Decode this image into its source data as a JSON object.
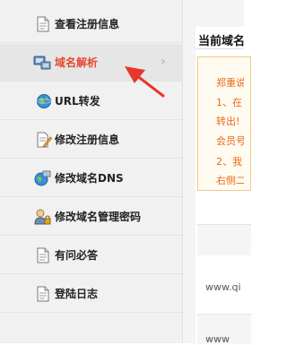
{
  "menu": {
    "items": [
      {
        "label": "查看注册信息",
        "icon": "document-icon"
      },
      {
        "label": "域名解析",
        "icon": "dns-server-icon",
        "active": true
      },
      {
        "label": "URL转发",
        "icon": "globe-icon"
      },
      {
        "label": "修改注册信息",
        "icon": "edit-document-icon"
      },
      {
        "label": "修改域名DNS",
        "icon": "globe-computer-icon"
      },
      {
        "label": "修改域名管理密码",
        "icon": "user-lock-icon"
      },
      {
        "label": "有问必答",
        "icon": "document-icon"
      },
      {
        "label": "登陆日志",
        "icon": "document-icon"
      }
    ],
    "chevron": "›"
  },
  "content": {
    "title": "当前域名",
    "notice_lines": [
      "郑重说",
      "1、在",
      "转出!",
      "会员号",
      "2、我",
      "右侧二"
    ],
    "url_rows": [
      "www.qi",
      "www"
    ]
  },
  "colors": {
    "active_text": "#e8472e",
    "arrow": "#e8362a",
    "notice_text": "#e86a1a"
  }
}
